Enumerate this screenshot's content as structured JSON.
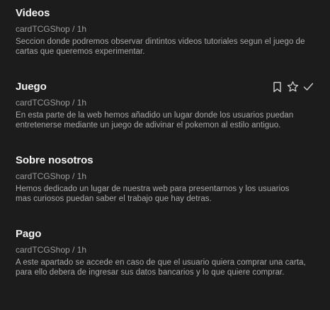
{
  "items": [
    {
      "title": "Videos",
      "meta": "cardTCGShop / 1h",
      "description": "Seccion donde podremos observar dintintos videos tutoriales segun el juego de cartas que queremos experimentar."
    },
    {
      "title": "Juego",
      "meta": "cardTCGShop / 1h",
      "description": "En esta parte de la web hemos añadido un lugar donde los usuarios puedan entretenerse mediante un juego de adivinar el pokemon al estilo antiguo.",
      "actions": [
        "bookmark-icon",
        "star-icon",
        "check-icon"
      ]
    },
    {
      "title": "Sobre nosotros",
      "meta": "cardTCGShop / 1h",
      "description": "Hemos dedicado un lugar de nuestra web para presentarnos y los usuarios mas curiosos puedan saber el trabajo que hay detras."
    },
    {
      "title": "Pago",
      "meta": "cardTCGShop / 1h",
      "description": "A este apartado se accede en caso de que el usuario quiera comprar una carta, para ello debera de ingresar sus datos bancarios y lo que quiere comprar."
    }
  ],
  "colors": {
    "background": "#1c1c1c",
    "title": "#f2f2f2",
    "meta": "#9a9a9a",
    "description": "#a8a8a8",
    "icon": "#cfcfcf"
  }
}
